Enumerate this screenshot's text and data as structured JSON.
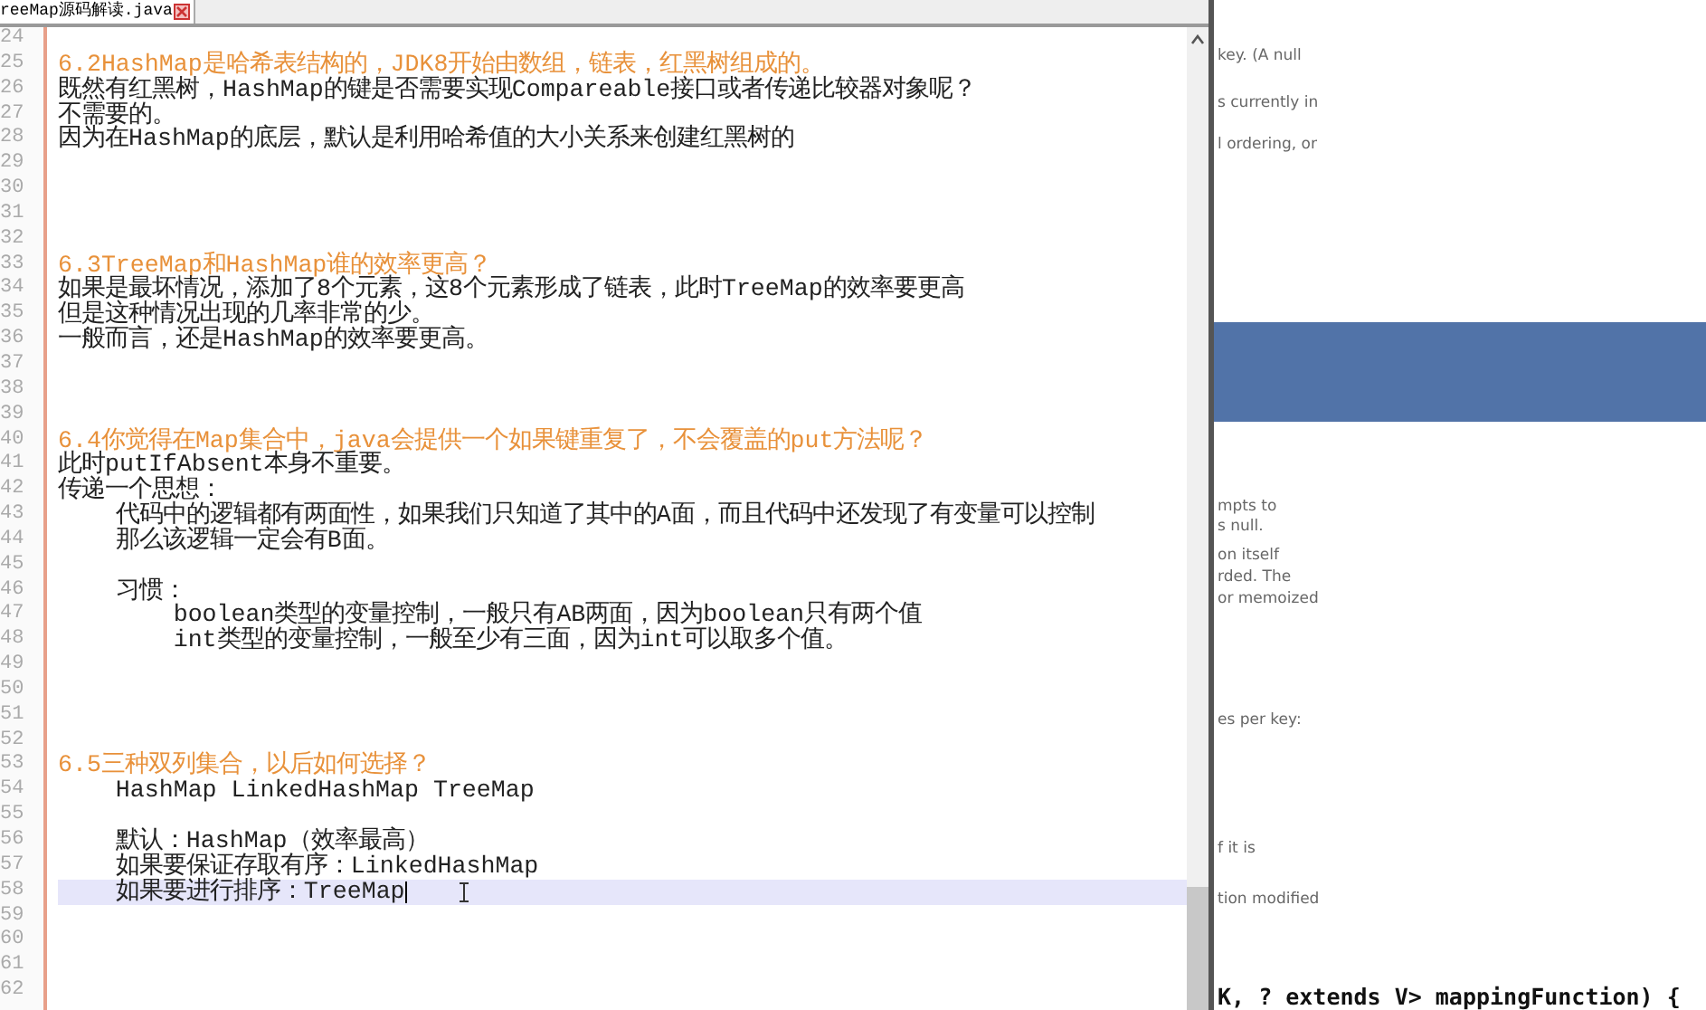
{
  "editor": {
    "tab": {
      "title": "reeMap源码解读.java",
      "selected": true
    },
    "lines": [
      {
        "number": "24",
        "kind": "blank",
        "selected": false
      },
      {
        "number": "25",
        "kind": "heading",
        "text": "6.2HashMap是哈希表结构的，JDK8开始由数组，链表，红黑树组成的。",
        "selected": false
      },
      {
        "number": "26",
        "kind": "text",
        "text": "既然有红黑树，HashMap的键是否需要实现Compareable接口或者传递比较器对象呢？",
        "selected": false
      },
      {
        "number": "27",
        "kind": "text",
        "text": "不需要的。",
        "selected": false
      },
      {
        "number": "28",
        "kind": "text",
        "text": "因为在HashMap的底层，默认是利用哈希值的大小关系来创建红黑树的",
        "selected": false
      },
      {
        "number": "29",
        "kind": "blank",
        "selected": false
      },
      {
        "number": "30",
        "kind": "blank",
        "selected": false
      },
      {
        "number": "31",
        "kind": "blank",
        "selected": false
      },
      {
        "number": "32",
        "kind": "blank",
        "selected": false
      },
      {
        "number": "33",
        "kind": "heading",
        "text": "6.3TreeMap和HashMap谁的效率更高？",
        "selected": false
      },
      {
        "number": "34",
        "kind": "text",
        "text": "如果是最坏情况，添加了8个元素，这8个元素形成了链表，此时TreeMap的效率要更高",
        "selected": false
      },
      {
        "number": "35",
        "kind": "text",
        "text": "但是这种情况出现的几率非常的少。",
        "selected": false
      },
      {
        "number": "36",
        "kind": "text",
        "text": "一般而言，还是HashMap的效率要更高。",
        "selected": false
      },
      {
        "number": "37",
        "kind": "blank",
        "selected": false
      },
      {
        "number": "38",
        "kind": "blank",
        "selected": false
      },
      {
        "number": "39",
        "kind": "blank",
        "selected": false
      },
      {
        "number": "40",
        "kind": "heading",
        "text": "6.4你觉得在Map集合中，java会提供一个如果键重复了，不会覆盖的put方法呢？",
        "selected": false
      },
      {
        "number": "41",
        "kind": "text",
        "text": "此时putIfAbsent本身不重要。",
        "selected": false
      },
      {
        "number": "42",
        "kind": "text",
        "text": "传递一个思想：",
        "selected": false
      },
      {
        "number": "43",
        "kind": "text",
        "text": "    代码中的逻辑都有两面性，如果我们只知道了其中的A面，而且代码中还发现了有变量可以控制",
        "selected": false
      },
      {
        "number": "44",
        "kind": "text",
        "text": "    那么该逻辑一定会有B面。",
        "selected": false
      },
      {
        "number": "45",
        "kind": "blank",
        "selected": false
      },
      {
        "number": "46",
        "kind": "text",
        "text": "    习惯：",
        "selected": false
      },
      {
        "number": "47",
        "kind": "text",
        "text": "        boolean类型的变量控制，一般只有AB两面，因为boolean只有两个值",
        "selected": false
      },
      {
        "number": "48",
        "kind": "text",
        "text": "        int类型的变量控制，一般至少有三面，因为int可以取多个值。",
        "selected": false
      },
      {
        "number": "49",
        "kind": "blank",
        "selected": false
      },
      {
        "number": "50",
        "kind": "blank",
        "selected": false
      },
      {
        "number": "51",
        "kind": "blank",
        "selected": false
      },
      {
        "number": "52",
        "kind": "blank",
        "selected": false
      },
      {
        "number": "53",
        "kind": "heading",
        "text": "6.5三种双列集合，以后如何选择？",
        "selected": false
      },
      {
        "number": "54",
        "kind": "text",
        "text": "    HashMap LinkedHashMap TreeMap",
        "selected": false
      },
      {
        "number": "55",
        "kind": "blank",
        "selected": false
      },
      {
        "number": "56",
        "kind": "text",
        "text": "    默认：HashMap（效率最高）",
        "selected": false
      },
      {
        "number": "57",
        "kind": "text",
        "text": "    如果要保证存取有序：LinkedHashMap",
        "selected": false
      },
      {
        "number": "58",
        "kind": "text",
        "text": "    如果要进行排序：TreeMap",
        "selected": true
      },
      {
        "number": "59",
        "kind": "blank",
        "selected": false
      },
      {
        "number": "60",
        "kind": "blank",
        "selected": false
      },
      {
        "number": "61",
        "kind": "blank",
        "selected": false
      },
      {
        "number": "62",
        "kind": "blank",
        "selected": false
      }
    ]
  },
  "background_doc": {
    "fragments": [
      {
        "kind": "text",
        "text": "key. (A null"
      },
      {
        "kind": "text",
        "text": "s currently in"
      },
      {
        "kind": "text",
        "text": "l ordering, or"
      },
      {
        "kind": "band"
      },
      {
        "kind": "text",
        "text": "mpts to"
      },
      {
        "kind": "text",
        "text": "s null."
      },
      {
        "kind": "text",
        "text": "on itself"
      },
      {
        "kind": "text",
        "text": "rded. The"
      },
      {
        "kind": "text",
        "text": "or memoized"
      },
      {
        "kind": "text",
        "text": "es per key:"
      },
      {
        "kind": "text",
        "text": "f it is"
      },
      {
        "kind": "text",
        "text": "tion modified"
      },
      {
        "kind": "code",
        "text": "K, ? extends V> mappingFunction) {"
      }
    ]
  }
}
